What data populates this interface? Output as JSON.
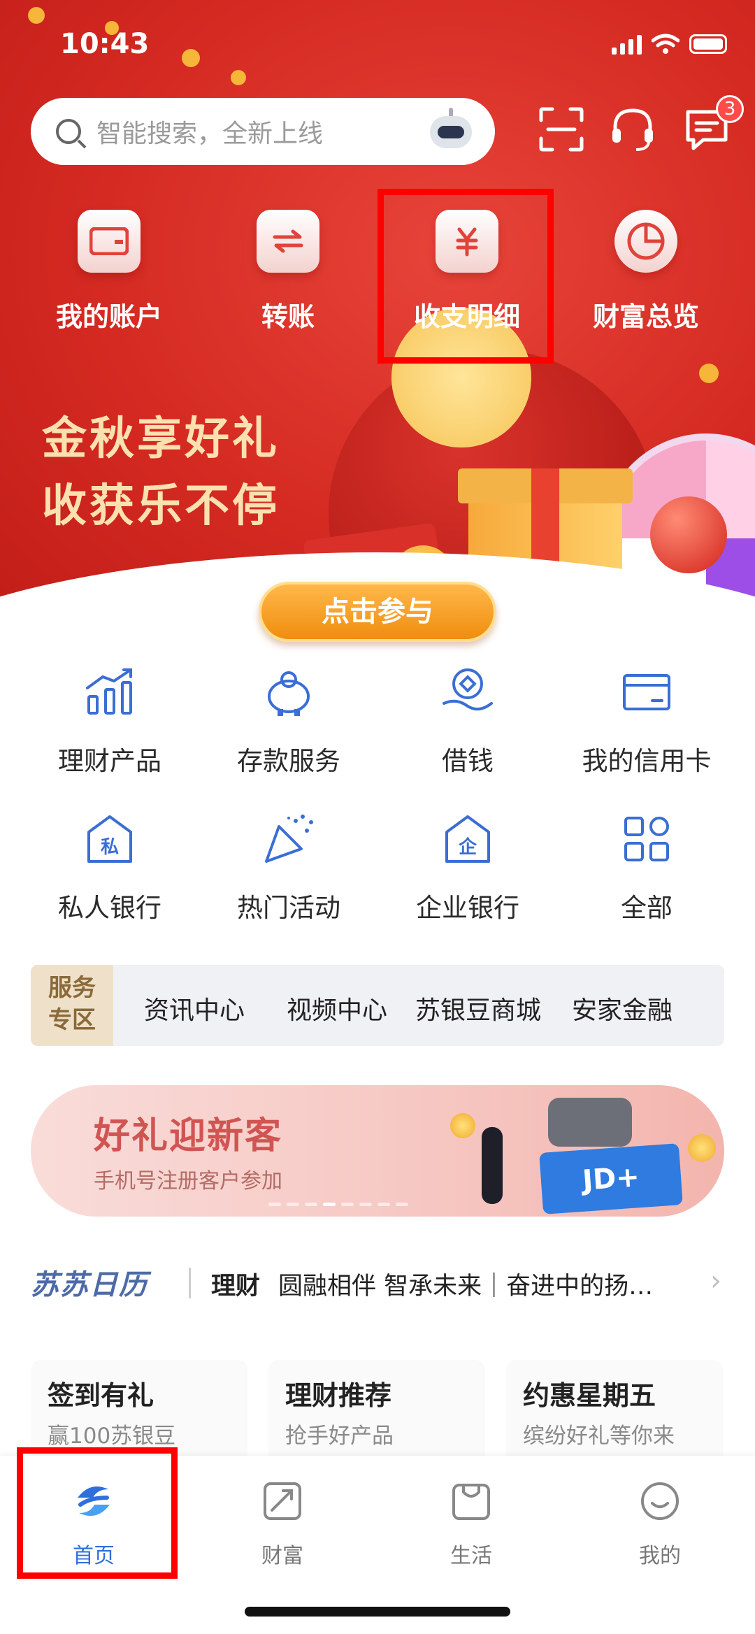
{
  "status_bar": {
    "time": "10:43"
  },
  "search": {
    "placeholder": "智能搜索，全新上线"
  },
  "header": {
    "message_badge": "3"
  },
  "quick_actions": [
    {
      "label": "我的账户",
      "icon": "wallet-icon"
    },
    {
      "label": "转账",
      "icon": "transfer-icon"
    },
    {
      "label": "收支明细",
      "icon": "yuan-ledger-icon"
    },
    {
      "label": "财富总览",
      "icon": "pie-chart-icon"
    }
  ],
  "promo": {
    "line1": "金秋享好礼",
    "line2": "收获乐不停",
    "button": "点击参与"
  },
  "services": [
    {
      "label": "理财产品",
      "icon": "bar-chart-icon"
    },
    {
      "label": "存款服务",
      "icon": "piggy-bank-icon"
    },
    {
      "label": "借钱",
      "icon": "coin-hand-icon"
    },
    {
      "label": "我的信用卡",
      "icon": "credit-card-icon"
    },
    {
      "label": "私人银行",
      "icon": "private-bank-icon"
    },
    {
      "label": "热门活动",
      "icon": "party-popper-icon"
    },
    {
      "label": "企业银行",
      "icon": "enterprise-bank-icon"
    },
    {
      "label": "全部",
      "icon": "grid-icon"
    }
  ],
  "service_zone": {
    "tag_line1": "服务",
    "tag_line2": "专区",
    "links": [
      "资讯中心",
      "视频中心",
      "苏银豆商城",
      "安家金融"
    ]
  },
  "banner": {
    "title": "好礼迎新客",
    "subtitle": "手机号注册客户参加",
    "card_text": "JD+"
  },
  "ticker": {
    "brand": "苏苏日历",
    "category": "理财",
    "text": "圆融相伴 智承未来｜奋进中的扬…"
  },
  "features": [
    {
      "title": "签到有礼",
      "subtitle": "赢100苏银豆"
    },
    {
      "title": "理财推荐",
      "subtitle": "抢手好产品"
    },
    {
      "title": "约惠星期五",
      "subtitle": "缤纷好礼等你来"
    }
  ],
  "tabs": [
    {
      "label": "首页",
      "active": true
    },
    {
      "label": "财富",
      "active": false
    },
    {
      "label": "生活",
      "active": false
    },
    {
      "label": "我的",
      "active": false
    }
  ],
  "colors": {
    "hero_red": "#d42a22",
    "accent_blue": "#2f6fdc",
    "highlight": "#ff0000"
  }
}
